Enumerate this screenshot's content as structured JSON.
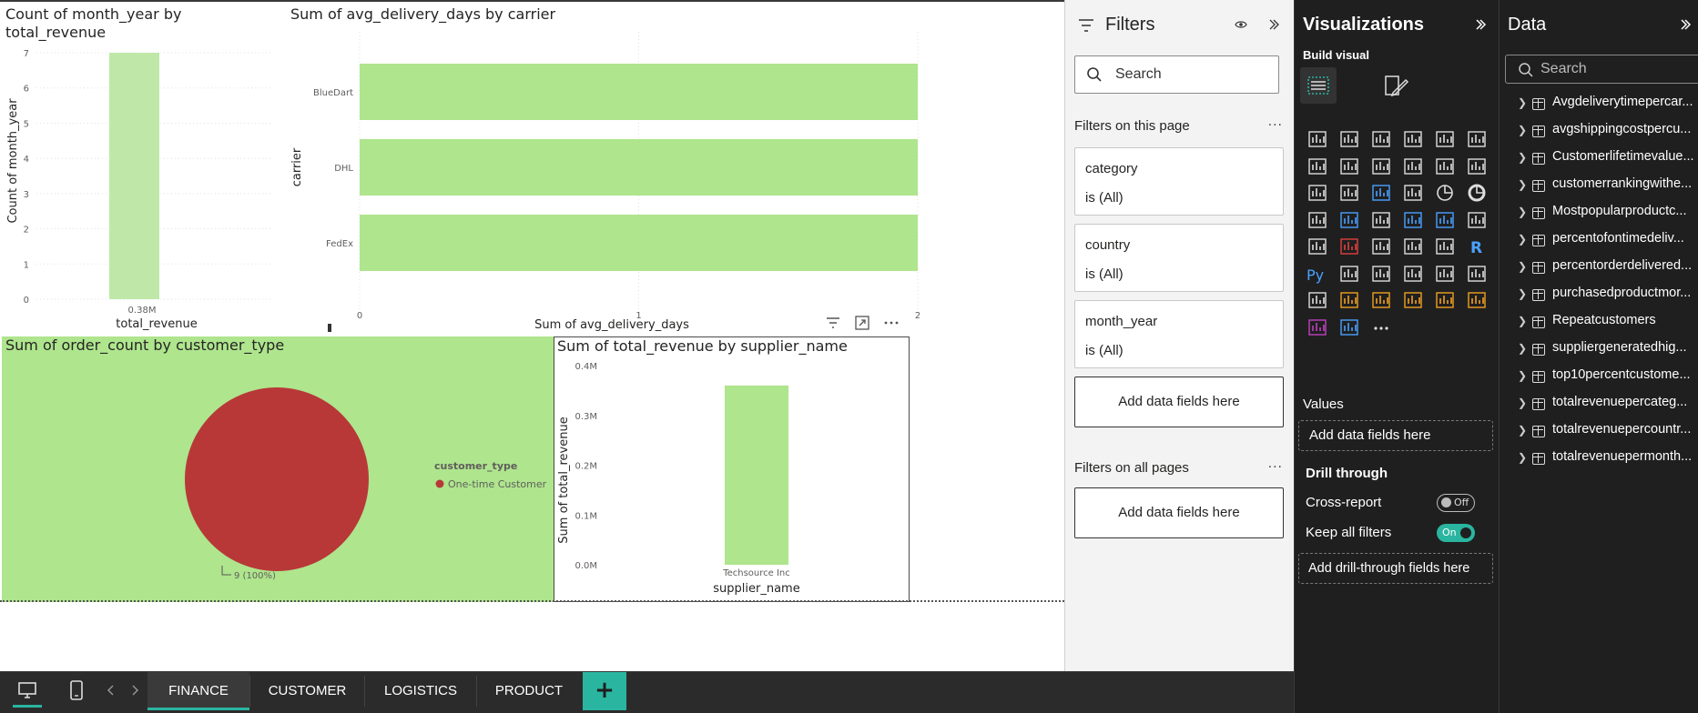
{
  "canvas": {
    "visual1": {
      "title_line1": "Count of month_year by",
      "title_line2": "total_revenue",
      "ylabel": "Count of month_year",
      "xlabel": "total_revenue",
      "yticks": [
        "0",
        "1",
        "2",
        "3",
        "4",
        "5",
        "6",
        "7"
      ],
      "bar_label": "0.38M"
    },
    "visual2": {
      "title": "Sum of avg_delivery_days by carrier",
      "ylabel": "carrier",
      "xlabel": "Sum of avg_delivery_days",
      "categories": [
        "BlueDart",
        "DHL",
        "FedEx"
      ],
      "xticks": [
        "0",
        "1",
        "2"
      ]
    },
    "visual3": {
      "title": "Sum of order_count by customer_type",
      "legend_title": "customer_type",
      "legend_item": "One-time Customer",
      "slice_label": "9 (100%)"
    },
    "visual4": {
      "title": "Sum of total_revenue by supplier_name",
      "ylabel": "Sum of total_revenue",
      "xlabel": "supplier_name",
      "yticks": [
        "0.0M",
        "0.1M",
        "0.2M",
        "0.3M",
        "0.4M"
      ],
      "category": "Techsource Inc"
    }
  },
  "chart_data": [
    {
      "type": "bar",
      "title": "Count of month_year by total_revenue",
      "xlabel": "total_revenue",
      "ylabel": "Count of month_year",
      "categories": [
        "0.38M"
      ],
      "values": [
        7
      ],
      "ylim": [
        0,
        7
      ],
      "color": "#bfe8a8"
    },
    {
      "type": "bar",
      "orientation": "horizontal",
      "title": "Sum of avg_delivery_days by carrier",
      "xlabel": "Sum of avg_delivery_days",
      "ylabel": "carrier",
      "categories": [
        "BlueDart",
        "DHL",
        "FedEx"
      ],
      "values": [
        2,
        2,
        2
      ],
      "xlim": [
        0,
        2
      ],
      "color": "#aee58d"
    },
    {
      "type": "pie",
      "title": "Sum of order_count by customer_type",
      "categories": [
        "One-time Customer"
      ],
      "values": [
        9
      ],
      "color": "#b83838"
    },
    {
      "type": "bar",
      "title": "Sum of total_revenue by supplier_name",
      "xlabel": "supplier_name",
      "ylabel": "Sum of total_revenue",
      "categories": [
        "Techsource Inc"
      ],
      "values": [
        0.36
      ],
      "ylim": [
        0,
        0.4
      ],
      "color": "#aee58d"
    }
  ],
  "tabs": [
    "FINANCE",
    "CUSTOMER",
    "LOGISTICS",
    "PRODUCT"
  ],
  "active_tab": "FINANCE",
  "filters": {
    "title": "Filters",
    "search_placeholder": "Search",
    "on_page_label": "Filters on this page",
    "cards": [
      {
        "name": "category",
        "state": "is (All)"
      },
      {
        "name": "country",
        "state": "is (All)"
      },
      {
        "name": "month_year",
        "state": "is (All)"
      }
    ],
    "add_fields": "Add data fields here",
    "all_pages_label": "Filters on all pages",
    "add_fields_all": "Add data fields here"
  },
  "visualizations": {
    "title": "Visualizations",
    "build_visual": "Build visual",
    "values_label": "Values",
    "values_add": "Add data fields here",
    "drill_through": "Drill through",
    "cross_report": "Cross-report",
    "cross_report_state": "Off",
    "keep_filters": "Keep all filters",
    "keep_filters_state": "On",
    "drill_add": "Add drill-through fields here",
    "accent": "#2ab5a0"
  },
  "data": {
    "title": "Data",
    "search_placeholder": "Search",
    "items": [
      "Avgdeliverytimepercar...",
      "avgshippingcostpercu...",
      "Customerlifetimevalue...",
      "customerrankingwithe...",
      "Mostpopularproductc...",
      "percentofontimedeliv...",
      "percentorderdelivered...",
      "purchasedproductmor...",
      "Repeatcustomers",
      "suppliergeneratedhig...",
      "top10percentcustome...",
      "totalrevenuepercateg...",
      "totalrevenuepercountr...",
      "totalrevenuepermonth..."
    ]
  }
}
